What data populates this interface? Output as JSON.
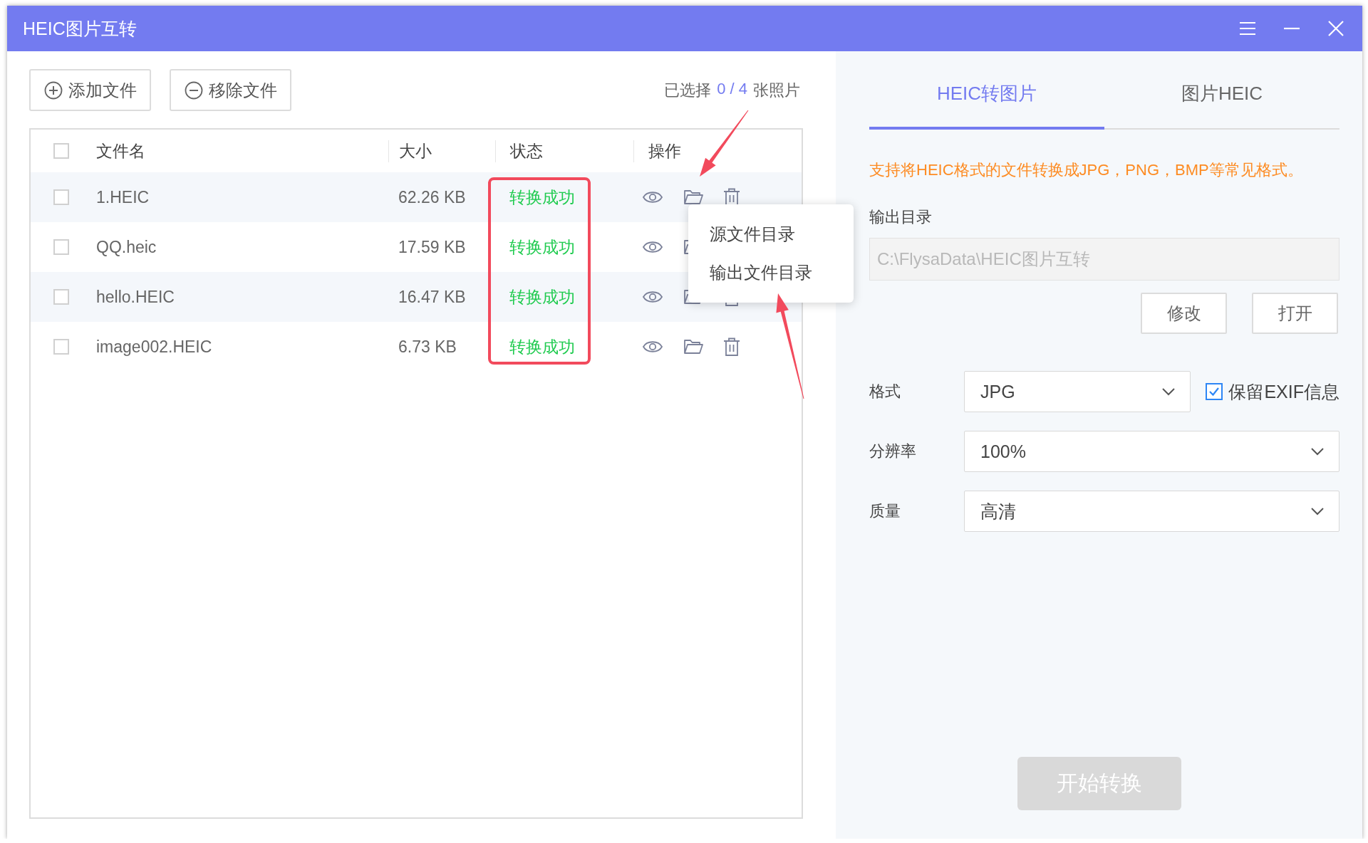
{
  "window": {
    "title": "HEIC图片互转"
  },
  "toolbar": {
    "buttons": [
      {
        "label": "添加文件",
        "kind": "add"
      },
      {
        "label": "移除文件",
        "kind": "remove"
      }
    ],
    "selection": {
      "prefix": "已选择",
      "count": "0 / 4",
      "suffix": "张照片"
    }
  },
  "table": {
    "columns": [
      "文件名",
      "大小",
      "状态",
      "操作"
    ],
    "all_checked": false,
    "rows": [
      {
        "name": "1.HEIC",
        "size": "62.26 KB",
        "status": "转换成功",
        "color": "#1fcb4f",
        "checked": false,
        "actions": [
          {
            "kind": "view"
          },
          {
            "kind": "folder"
          },
          {
            "kind": "delete"
          }
        ]
      },
      {
        "name": "QQ.heic",
        "size": "17.59 KB",
        "status": "转换成功",
        "color": "#1fcb4f",
        "checked": false,
        "actions": [
          {
            "kind": "view"
          },
          {
            "kind": "folder"
          }
        ]
      },
      {
        "name": "hello.HEIC",
        "size": "16.47 KB",
        "status": "转换成功",
        "color": "#1fcb4f",
        "checked": false,
        "actions": [
          {
            "kind": "view"
          },
          {
            "kind": "folder"
          },
          {
            "kind": "delete"
          }
        ]
      },
      {
        "name": "image002.HEIC",
        "size": "6.73 KB",
        "status": "转换成功",
        "color": "#1fcb4f",
        "checked": false,
        "actions": [
          {
            "kind": "view"
          },
          {
            "kind": "folder"
          },
          {
            "kind": "delete"
          }
        ]
      }
    ]
  },
  "context_menu": {
    "items": [
      "源文件目录",
      "输出文件目录"
    ]
  },
  "annotations": [
    {
      "kind": "highlight_box"
    },
    {
      "kind": "arrow"
    },
    {
      "kind": "arrow"
    }
  ],
  "settings": {
    "tabs": [
      {
        "label": "HEIC转图片",
        "selected": true
      },
      {
        "label": "图片HEIC",
        "selected": false
      }
    ],
    "hint": "支持将HEIC格式的文件转换成JPG，PNG，BMP等常见格式。",
    "output_dir": {
      "label": "输出目录",
      "value": "C:\\FlysaData\\HEIC图片互转",
      "buttons": [
        "修改",
        "打开"
      ]
    },
    "fields": [
      {
        "label": "格式",
        "value": "JPG",
        "kind": "select_with_check",
        "check": {
          "label": "保留EXIF信息",
          "checked": true
        }
      },
      {
        "label": "分辨率",
        "value": "100%",
        "kind": "select"
      },
      {
        "label": "质量",
        "value": "高清",
        "kind": "select"
      }
    ],
    "start_button": {
      "label": "开始转换",
      "disabled": true
    }
  }
}
